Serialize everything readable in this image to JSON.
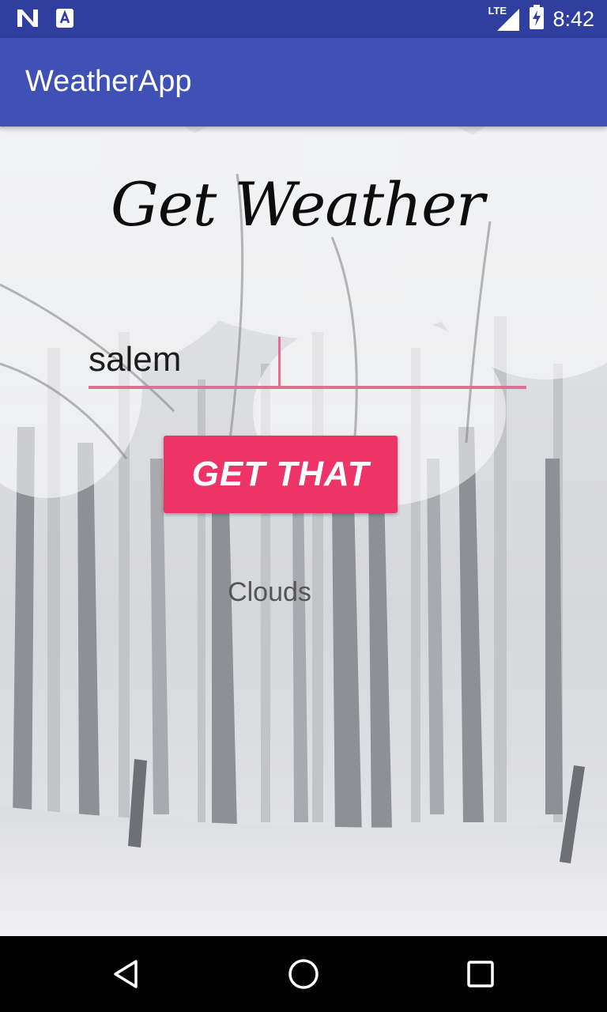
{
  "status_bar": {
    "time": "8:42",
    "network_label": "LTE",
    "icons": [
      "n-logo-icon",
      "a-notification-icon",
      "signal-icon",
      "battery-charging-icon"
    ]
  },
  "app_bar": {
    "title": "WeatherApp"
  },
  "main": {
    "heading": "Get Weather",
    "city_input": {
      "value": "salem",
      "placeholder": ""
    },
    "get_button_label": "GET THAT",
    "result_text": "Clouds"
  },
  "nav_bar": {
    "icons": [
      "back-icon",
      "home-icon",
      "recents-icon"
    ]
  },
  "colors": {
    "status_bar": "#303f9f",
    "app_bar": "#3f51b5",
    "accent": "#ee3366",
    "input_underline": "#e0708f"
  }
}
